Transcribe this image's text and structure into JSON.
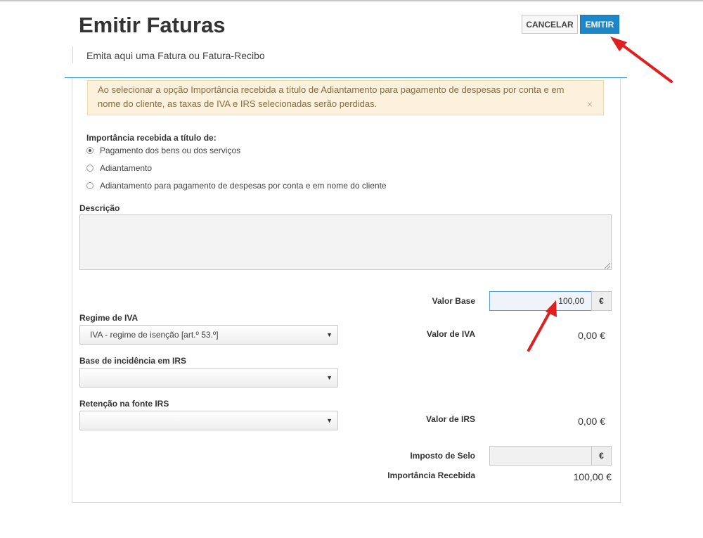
{
  "header": {
    "title": "Emitir Faturas",
    "subtitle": "Emita aqui uma Fatura ou Fatura-Recibo",
    "cancel_label": "CANCELAR",
    "emit_label": "EMITIR"
  },
  "alert": {
    "text": "Ao selecionar a opção Importância recebida a título de Adiantamento para pagamento de despesas por conta e em nome do cliente, as taxas de IVA e IRS selecionadas serão perdidas.",
    "close": "×"
  },
  "importance": {
    "label": "Importância recebida a título de:",
    "options": [
      {
        "label": "Pagamento dos bens ou dos serviços",
        "checked": true
      },
      {
        "label": "Adiantamento",
        "checked": false
      },
      {
        "label": "Adiantamento para pagamento de despesas por conta e em nome do cliente",
        "checked": false
      }
    ]
  },
  "description": {
    "label": "Descrição",
    "value": ""
  },
  "regime_iva": {
    "label": "Regime de IVA",
    "selected": "IVA - regime de isenção [art.º 53.º]"
  },
  "base_irs": {
    "label": "Base de incidência em IRS",
    "selected": ""
  },
  "retencao_irs": {
    "label": "Retenção na fonte IRS",
    "selected": ""
  },
  "totals": {
    "valor_base_label": "Valor Base",
    "valor_base_value": "100,00",
    "currency": "€",
    "valor_iva_label": "Valor de IVA",
    "valor_iva_value": "0,00 €",
    "valor_irs_label": "Valor de IRS",
    "valor_irs_value": "0,00 €",
    "imposto_selo_label": "Imposto de Selo",
    "imposto_selo_value": "",
    "importancia_label": "Importância Recebida",
    "importancia_value": "100,00 €"
  },
  "colors": {
    "accent": "#1c87c9",
    "arrow": "#e02020",
    "alert_bg": "#fbf1dc",
    "alert_text": "#8a6d3b"
  },
  "icons": {
    "close": "close-icon",
    "caret": "chevron-down-icon"
  }
}
